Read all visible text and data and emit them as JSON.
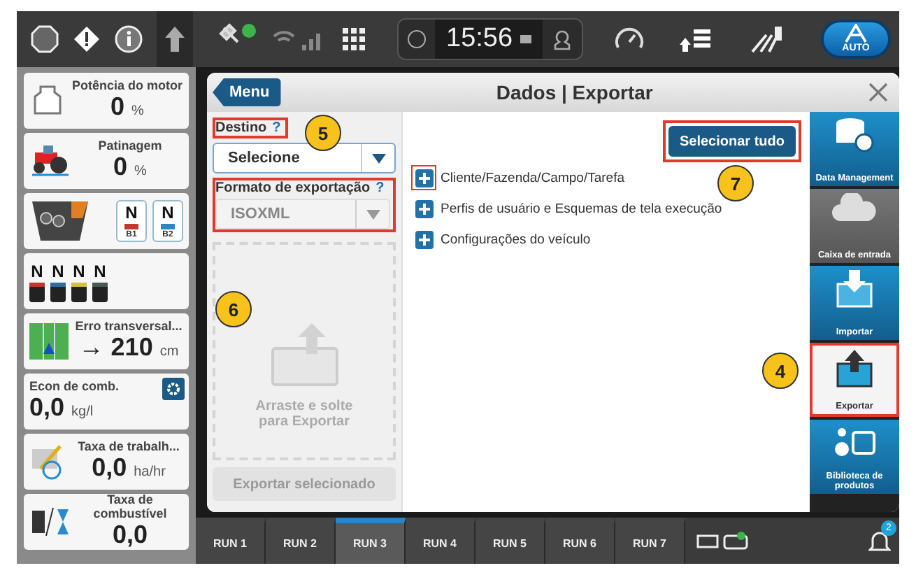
{
  "status_bar": {
    "time": "15:56",
    "auto_label": "AUTO"
  },
  "widgets": [
    {
      "kind": "metric",
      "title": "Potência do motor",
      "value": "0",
      "unit": "%"
    },
    {
      "kind": "metric",
      "title": "Patinagem",
      "value": "0",
      "unit": "%"
    },
    {
      "kind": "brakes",
      "items": [
        {
          "state": "N",
          "label": "B1",
          "color": "#c0392b"
        },
        {
          "state": "N",
          "label": "B2",
          "color": "#2e86c1"
        }
      ]
    },
    {
      "kind": "remotes",
      "items": [
        {
          "state": "N",
          "color": "#c0392b"
        },
        {
          "state": "N",
          "color": "#2e6da4"
        },
        {
          "state": "N",
          "color": "#d4c23a"
        },
        {
          "state": "N",
          "color": "#4a5a50"
        }
      ]
    },
    {
      "kind": "metric",
      "title": "Erro transversal...",
      "value": "→ 210",
      "unit": "cm"
    },
    {
      "kind": "setting",
      "title": "Econ de comb.",
      "value": "0,0",
      "unit": "kg/l"
    },
    {
      "kind": "metric",
      "title": "Taxa de trabalh...",
      "value": "0,0",
      "unit": "ha/hr"
    },
    {
      "kind": "metric",
      "title": "Taxa de combustível",
      "value": "0,0"
    }
  ],
  "dialog": {
    "menu_button": "Menu",
    "title": "Dados | Exportar",
    "destination": {
      "label": "Destino",
      "help": "?",
      "value": "Selecione",
      "disabled": false,
      "highlighted": true,
      "callout": "5"
    },
    "format": {
      "label": "Formato de exportação",
      "help": "?",
      "value": "ISOXML",
      "disabled": true,
      "highlighted": true
    },
    "dropzone": {
      "text": "Arraste e solte para Exportar",
      "callout": "6"
    },
    "export_button": {
      "label": "Exportar selecionado",
      "disabled": true
    },
    "select_all": {
      "label": "Selecionar tudo",
      "highlighted": true,
      "callout": "7"
    },
    "items": [
      {
        "label": "Cliente/Fazenda/Campo/Tarefa",
        "highlighted": true
      },
      {
        "label": "Perfis de usuário e Esquemas de tela execução",
        "highlighted": false
      },
      {
        "label": "Configurações do veículo",
        "highlighted": false
      }
    ],
    "side_nav": [
      {
        "label": "Data Management",
        "selected": false,
        "disabled": false,
        "highlighted": false
      },
      {
        "label": "Caixa de entrada",
        "selected": false,
        "disabled": true,
        "highlighted": false
      },
      {
        "label": "Importar",
        "selected": false,
        "disabled": false,
        "highlighted": false
      },
      {
        "label": "Exportar",
        "selected": true,
        "disabled": false,
        "highlighted": true,
        "callout": "4"
      },
      {
        "label": "Biblioteca de produtos",
        "selected": false,
        "disabled": false,
        "highlighted": false
      }
    ]
  },
  "run_tabs": [
    {
      "label": "RUN 1",
      "selected": false
    },
    {
      "label": "RUN 2",
      "selected": false
    },
    {
      "label": "RUN 3",
      "selected": true
    },
    {
      "label": "RUN 4",
      "selected": false
    },
    {
      "label": "RUN 5",
      "selected": false
    },
    {
      "label": "RUN 6",
      "selected": false
    },
    {
      "label": "RUN 7",
      "selected": false
    }
  ],
  "notifications": {
    "count": "2"
  }
}
